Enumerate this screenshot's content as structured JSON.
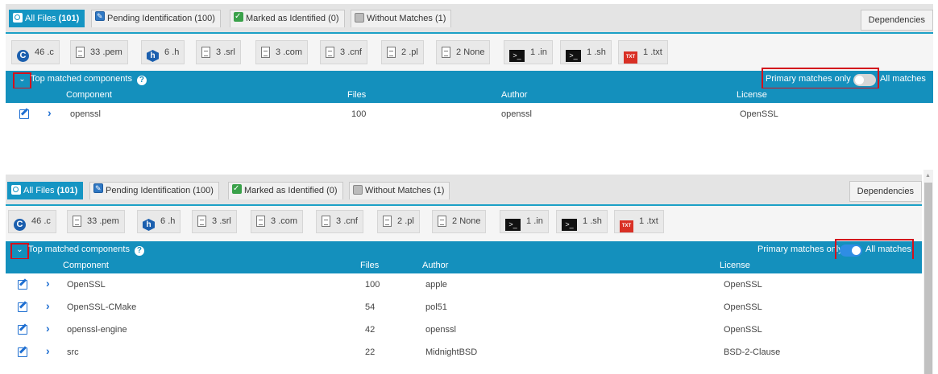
{
  "panels": [
    {
      "tabs": [
        {
          "label": "All Files",
          "count": "(101)",
          "icon": "search-icon",
          "active": true
        },
        {
          "label": "Pending Identification",
          "count": "(100)",
          "icon": "pending-icon",
          "active": false
        },
        {
          "label": "Marked as Identified",
          "count": "(0)",
          "icon": "check-icon",
          "active": false
        },
        {
          "label": "Without Matches",
          "count": "(1)",
          "icon": "no-match-icon",
          "active": false
        }
      ],
      "dependencies_label": "Dependencies",
      "extensions": [
        {
          "count": "46",
          "ext": ".c",
          "icon": "c-language-icon"
        },
        {
          "count": "33",
          "ext": ".pem",
          "icon": "document-icon"
        },
        {
          "count": "6",
          "ext": ".h",
          "icon": "header-file-icon"
        },
        {
          "count": "3",
          "ext": ".srl",
          "icon": "document-icon"
        },
        {
          "count": "3",
          "ext": ".com",
          "icon": "document-icon"
        },
        {
          "count": "3",
          "ext": ".cnf",
          "icon": "document-icon"
        },
        {
          "count": "2",
          "ext": ".pl",
          "icon": "document-icon"
        },
        {
          "count": "2",
          "ext": "None",
          "icon": "document-icon"
        },
        {
          "count": "1",
          "ext": ".in",
          "icon": "terminal-icon"
        },
        {
          "count": "1",
          "ext": ".sh",
          "icon": "terminal-icon"
        },
        {
          "count": "1",
          "ext": ".txt",
          "icon": "txt-file-icon"
        }
      ],
      "components_title": "Top matched components",
      "toggle": {
        "primary_label": "Primary matches only",
        "all_label": "All matches",
        "state": "primary"
      },
      "columns": {
        "component": "Component",
        "files": "Files",
        "author": "Author",
        "license": "License"
      },
      "rows": [
        {
          "component": "openssl",
          "files": "100",
          "author": "openssl",
          "license": "OpenSSL"
        }
      ]
    },
    {
      "tabs": [
        {
          "label": "All Files",
          "count": "(101)",
          "icon": "search-icon",
          "active": true
        },
        {
          "label": "Pending Identification",
          "count": "(100)",
          "icon": "pending-icon",
          "active": false
        },
        {
          "label": "Marked as Identified",
          "count": "(0)",
          "icon": "check-icon",
          "active": false
        },
        {
          "label": "Without Matches",
          "count": "(1)",
          "icon": "no-match-icon",
          "active": false
        }
      ],
      "dependencies_label": "Dependencies",
      "extensions": [
        {
          "count": "46",
          "ext": ".c",
          "icon": "c-language-icon"
        },
        {
          "count": "33",
          "ext": ".pem",
          "icon": "document-icon"
        },
        {
          "count": "6",
          "ext": ".h",
          "icon": "header-file-icon"
        },
        {
          "count": "3",
          "ext": ".srl",
          "icon": "document-icon"
        },
        {
          "count": "3",
          "ext": ".com",
          "icon": "document-icon"
        },
        {
          "count": "3",
          "ext": ".cnf",
          "icon": "document-icon"
        },
        {
          "count": "2",
          "ext": ".pl",
          "icon": "document-icon"
        },
        {
          "count": "2",
          "ext": "None",
          "icon": "document-icon"
        },
        {
          "count": "1",
          "ext": ".in",
          "icon": "terminal-icon"
        },
        {
          "count": "1",
          "ext": ".sh",
          "icon": "terminal-icon"
        },
        {
          "count": "1",
          "ext": ".txt",
          "icon": "txt-file-icon"
        }
      ],
      "components_title": "Top matched components",
      "toggle": {
        "primary_label": "Primary matches only",
        "all_label": "All matches",
        "state": "all"
      },
      "columns": {
        "component": "Component",
        "files": "Files",
        "author": "Author",
        "license": "License"
      },
      "rows": [
        {
          "component": "OpenSSL",
          "files": "100",
          "author": "apple",
          "license": "OpenSSL"
        },
        {
          "component": "OpenSSL-CMake",
          "files": "54",
          "author": "pol51",
          "license": "OpenSSL"
        },
        {
          "component": "openssl-engine",
          "files": "42",
          "author": "openssl",
          "license": "OpenSSL"
        },
        {
          "component": "src",
          "files": "22",
          "author": "MidnightBSD",
          "license": "BSD-2-Clause"
        }
      ]
    }
  ],
  "colors": {
    "accent": "#1490bd",
    "highlight": "#d3111c",
    "toggle_on": "#2f8de4"
  }
}
